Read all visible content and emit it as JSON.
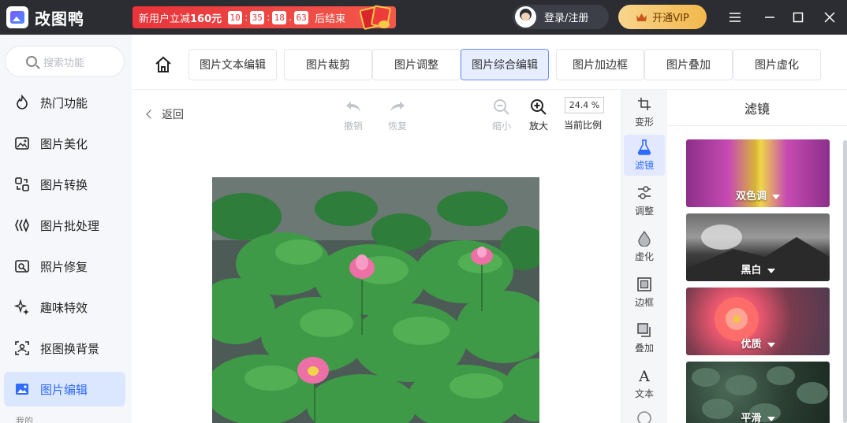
{
  "app": {
    "name": "改图鸭"
  },
  "promo": {
    "text_prefix": "新用户立减",
    "amount": "160元",
    "countdown": [
      "10",
      "35",
      "18",
      "63"
    ],
    "suffix": "后结束"
  },
  "header": {
    "login_label": "登录/注册",
    "vip_label": "开通VIP"
  },
  "sidebar": {
    "search_placeholder": "搜索功能",
    "items": [
      {
        "label": "热门功能",
        "icon": "fire-icon"
      },
      {
        "label": "图片美化",
        "icon": "image-beautify-icon"
      },
      {
        "label": "图片转换",
        "icon": "convert-icon"
      },
      {
        "label": "图片批处理",
        "icon": "batch-icon"
      },
      {
        "label": "照片修复",
        "icon": "repair-icon"
      },
      {
        "label": "趣味特效",
        "icon": "sparkle-icon"
      },
      {
        "label": "抠图换背景",
        "icon": "cutout-icon"
      },
      {
        "label": "图片编辑",
        "icon": "edit-image-icon",
        "active": true
      }
    ],
    "footer": "我的"
  },
  "tabs": [
    {
      "label": "图片文本编辑"
    },
    {
      "label": "图片裁剪"
    },
    {
      "label": "图片调整"
    },
    {
      "label": "图片综合编辑",
      "active": true
    },
    {
      "label": "图片加边框"
    },
    {
      "label": "图片叠加"
    },
    {
      "label": "图片虚化"
    }
  ],
  "editor": {
    "back_label": "返回",
    "undo_label": "撤销",
    "redo_label": "恢复",
    "zoom_out_label": "缩小",
    "zoom_in_label": "放大",
    "zoom_value": "24.4 %",
    "zoom_caption": "当前比例"
  },
  "strip": [
    {
      "label": "变形",
      "icon": "transform-icon"
    },
    {
      "label": "滤镜",
      "icon": "filter-flask-icon",
      "active": true
    },
    {
      "label": "调整",
      "icon": "adjust-icon"
    },
    {
      "label": "虚化",
      "icon": "blur-drop-icon"
    },
    {
      "label": "边框",
      "icon": "frame-icon"
    },
    {
      "label": "叠加",
      "icon": "overlay-icon"
    },
    {
      "label": "文本",
      "icon": "text-icon"
    }
  ],
  "panel": {
    "title": "滤镜",
    "filters": [
      {
        "label": "双色调"
      },
      {
        "label": "黑白"
      },
      {
        "label": "优质"
      },
      {
        "label": "平滑"
      }
    ]
  },
  "colors": {
    "accent": "#2f6bff",
    "titlebar": "#2b2d33",
    "promo": "#e8343a",
    "vip": "#f2b84b"
  }
}
